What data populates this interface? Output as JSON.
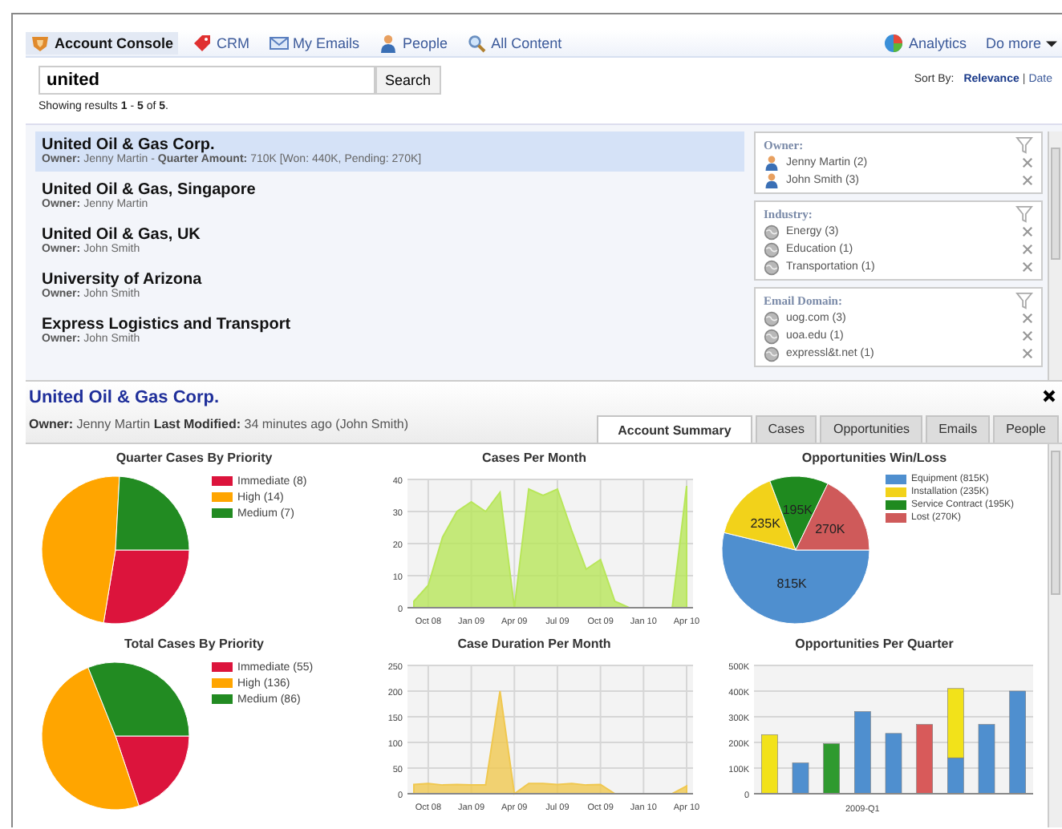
{
  "nav": {
    "items": [
      {
        "label": "Account Console",
        "selected": true
      },
      {
        "label": "CRM",
        "selected": false
      },
      {
        "label": "My Emails",
        "selected": false
      },
      {
        "label": "People",
        "selected": false
      },
      {
        "label": "All Content",
        "selected": false
      }
    ],
    "analytics": "Analytics",
    "more": "Do more"
  },
  "search": {
    "value": "united",
    "button": "Search",
    "summary": "Showing results **1** - **5** of **5**."
  },
  "sort": {
    "label": "Sort By:",
    "separator": "|",
    "options": [
      {
        "label": "Relevance",
        "selected": true
      },
      {
        "label": "Date",
        "selected": false
      }
    ]
  },
  "results": [
    {
      "title": "United Oil & Gas Corp.",
      "meta": "**Owner:** Jenny Martin - **Quarter Amount:** 710K [Won: 440K, Pending: 270K]",
      "selected": true
    },
    {
      "title": "United Oil & Gas, Singapore",
      "meta": "**Owner:** Jenny Martin",
      "selected": false
    },
    {
      "title": "United Oil & Gas, UK",
      "meta": "**Owner:** John Smith",
      "selected": false
    },
    {
      "title": "University of Arizona",
      "meta": "**Owner:** John Smith",
      "selected": false
    },
    {
      "title": "Express Logistics and Transport",
      "meta": "**Owner:** John Smith",
      "selected": false
    }
  ],
  "facets": [
    {
      "title": "Owner:",
      "kind": "person",
      "items": [
        "Jenny Martin (2)",
        "John Smith (3)"
      ]
    },
    {
      "title": "Industry:",
      "kind": "globe",
      "items": [
        "Energy (3)",
        "Education (1)",
        "Transportation (1)"
      ]
    },
    {
      "title": "Email Domain:",
      "kind": "globe",
      "items": [
        "uog.com (3)",
        "uoa.edu (1)",
        "expressl&t.net (1)"
      ]
    }
  ],
  "detail": {
    "title": "United Oil & Gas Corp.",
    "meta": "**Owner:** Jenny Martin **Last Modified:** 34 minutes ago (John Smith)",
    "tabs": [
      {
        "label": "Account Summary",
        "selected": true
      },
      {
        "label": "Cases",
        "selected": false
      },
      {
        "label": "Opportunities",
        "selected": false
      },
      {
        "label": "Emails",
        "selected": false
      },
      {
        "label": "People",
        "selected": false
      }
    ]
  },
  "charts": [
    {
      "chart_data": {
        "type": "pie",
        "title": "Quarter Cases By Priority",
        "categories": [
          "Immediate (8)",
          "High (14)",
          "Medium (7)"
        ],
        "values": [
          8,
          14,
          7
        ],
        "legend": "right",
        "colors": [
          "#dc143c",
          "#ffa500",
          "#228b22"
        ]
      }
    },
    {
      "chart_data": {
        "type": "area",
        "title": "Cases Per Month",
        "grid": true,
        "categories": [
          null,
          "Oct 08",
          null,
          null,
          "Jan 09",
          null,
          null,
          "Apr 09",
          null,
          null,
          "Jul 09",
          null,
          null,
          "Oct 09",
          null,
          null,
          "Jan 10",
          null,
          null,
          "Apr 10"
        ],
        "ylim": [
          0,
          40
        ],
        "yticks": [
          0,
          10,
          20,
          30,
          40
        ],
        "series": [
          {
            "color": "#b8e65a",
            "values": [
              2,
              7,
              22,
              30,
              33,
              30,
              36,
              0,
              37,
              35,
              37,
              24,
              12,
              15,
              2,
              0,
              0,
              0,
              0,
              38
            ]
          }
        ]
      }
    },
    {
      "chart_data": {
        "type": "pie",
        "title": "Opportunities Win/Loss",
        "categories": [
          "Equipment (815K)",
          "Installation (235K)",
          "Service Contract (195K)",
          "Lost (270K)"
        ],
        "values": [
          815,
          235,
          195,
          270
        ],
        "legend": "top-right",
        "colors": [
          "#4f8fcf",
          "#f2d21a",
          "#1f8a1f",
          "#cf5a5a"
        ],
        "value_labels": [
          "815K",
          "235K",
          "195K",
          "270K"
        ]
      }
    },
    {
      "chart_data": {
        "type": "pie",
        "title": "Total Cases By Priority",
        "categories": [
          "Immediate (55)",
          "High (136)",
          "Medium (86)"
        ],
        "values": [
          55,
          136,
          86
        ],
        "legend": "right",
        "colors": [
          "#dc143c",
          "#ffa500",
          "#228b22"
        ]
      }
    },
    {
      "chart_data": {
        "type": "area",
        "title": "Case Duration Per Month",
        "grid": true,
        "categories": [
          null,
          "Oct 08",
          null,
          null,
          "Jan 09",
          null,
          null,
          "Apr 09",
          null,
          null,
          "Jul 09",
          null,
          null,
          "Oct 09",
          null,
          null,
          "Jan 10",
          null,
          null,
          "Apr 10"
        ],
        "ylim": [
          0,
          250
        ],
        "yticks": [
          0,
          50,
          100,
          150,
          200,
          250
        ],
        "series": [
          {
            "color": "#f0c850",
            "values": [
              18,
              20,
              17,
              18,
              17,
              17,
              200,
              0,
              20,
              20,
              18,
              20,
              17,
              18,
              0,
              0,
              0,
              0,
              0,
              15
            ]
          }
        ]
      }
    },
    {
      "chart_data": {
        "type": "bar",
        "title": "Opportunities Per Quarter",
        "grid": true,
        "stacked": true,
        "categories": [
          null,
          null,
          null,
          "2009-Q1",
          null,
          null,
          null,
          null,
          null
        ],
        "ylim": [
          0,
          500
        ],
        "yticks": [
          {
            "value": 0,
            "label": "0"
          },
          {
            "value": 100,
            "label": "100K"
          },
          {
            "value": 200,
            "label": "200K"
          },
          {
            "value": 300,
            "label": "300K"
          },
          {
            "value": 400,
            "label": "400K"
          },
          {
            "value": 500,
            "label": "500K"
          }
        ],
        "series": [
          {
            "color": "#4f8fcf",
            "values": [
              null,
              120,
              null,
              320,
              235,
              null,
              140,
              270,
              400
            ]
          },
          {
            "color": "#f2e21a",
            "values": [
              230,
              null,
              null,
              null,
              null,
              null,
              270,
              null,
              null
            ]
          },
          {
            "color": "#2f9a2f",
            "values": [
              null,
              null,
              195,
              null,
              null,
              null,
              null,
              null,
              null
            ]
          },
          {
            "color": "#d85a5a",
            "values": [
              null,
              null,
              null,
              null,
              null,
              270,
              null,
              null,
              null
            ]
          }
        ]
      }
    }
  ]
}
